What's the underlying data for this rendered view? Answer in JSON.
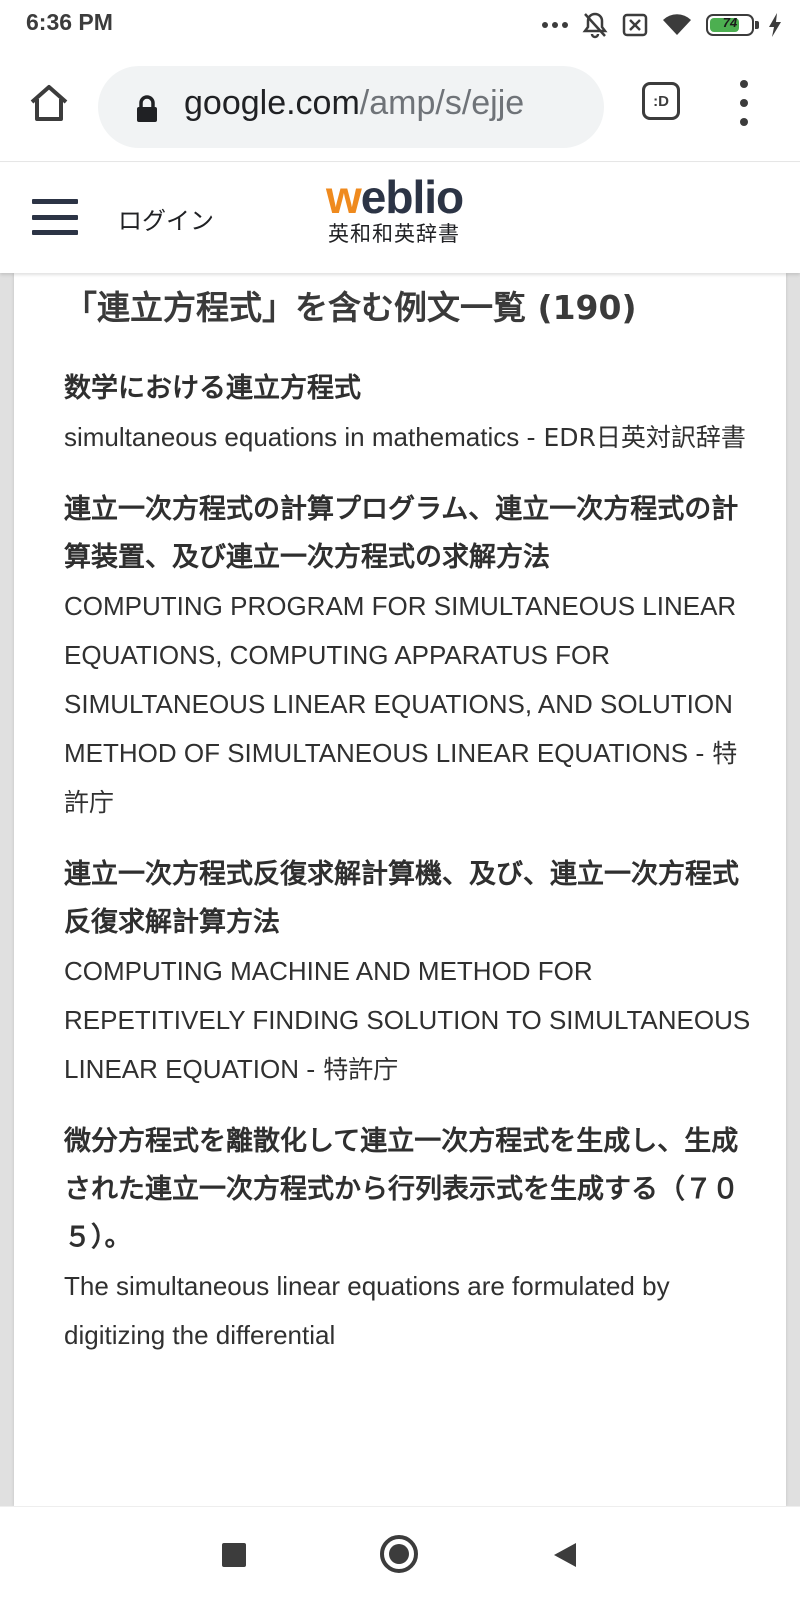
{
  "status_bar": {
    "time": "6:36 PM",
    "battery_percent": 74,
    "battery_label": "74",
    "icons": [
      "more-dots-icon",
      "bell-muted-icon",
      "sim-off-icon",
      "wifi-icon",
      "battery-icon",
      "charging-bolt-icon"
    ]
  },
  "browser": {
    "url_domain": "google.com",
    "url_path": "/amp/s/ejje",
    "tabs_label": ":D"
  },
  "site": {
    "login_label": "ログイン",
    "logo_prefix": "w",
    "logo_rest": "eblio",
    "logo_subtitle": "英和和英辞書"
  },
  "main": {
    "heading": "「連立方程式」を含む例文一覧 (190)",
    "examples": [
      {
        "ja": "数学における連立方程式",
        "en": "simultaneous equations in mathematics",
        "source": "- EDR日英対訳辞書"
      },
      {
        "ja": "連立一次方程式の計算プログラム、連立一次方程式の計算装置、及び連立一次方程式の求解方法",
        "en": "COMPUTING PROGRAM FOR SIMULTANEOUS LINEAR EQUATIONS, COMPUTING APPARATUS FOR SIMULTANEOUS LINEAR EQUATIONS, AND SOLUTION METHOD OF SIMULTANEOUS LINEAR EQUATIONS",
        "source": "- 特許庁"
      },
      {
        "ja": "連立一次方程式反復求解計算機、及び、連立一次方程式反復求解計算方法",
        "en": "COMPUTING MACHINE AND METHOD FOR REPETITIVELY FINDING SOLUTION TO SIMULTANEOUS LINEAR EQUATION",
        "source": "- 特許庁"
      },
      {
        "ja": "微分方程式を離散化して連立一次方程式を生成し、生成された連立一次方程式から行列表示式を生成する（７０５）。",
        "en": "The simultaneous linear equations are formulated by digitizing the differential",
        "source": ""
      }
    ]
  },
  "colors": {
    "logo_accent": "#ef8a1e",
    "logo_dark": "#2c3445",
    "battery_fill": "#4caf50"
  }
}
